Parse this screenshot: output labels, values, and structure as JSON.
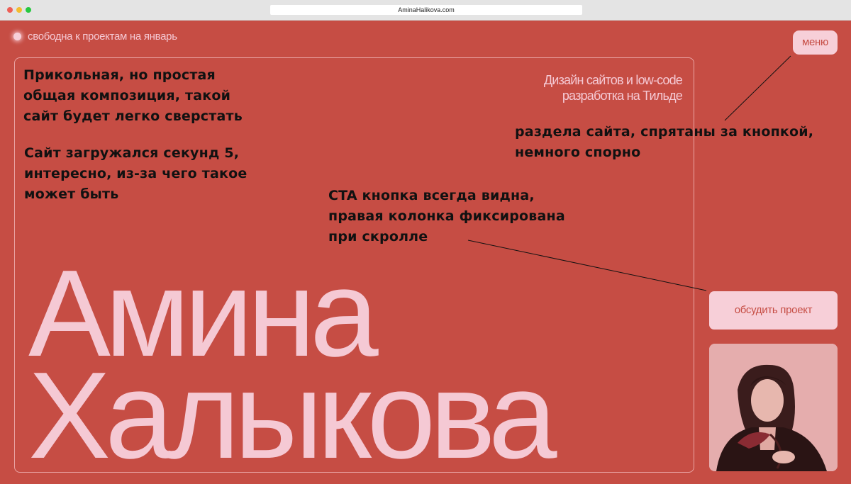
{
  "browser": {
    "url": "AminaHalikova.com"
  },
  "header": {
    "status_text": "свободна к проектам на январь",
    "menu_label": "меню"
  },
  "hero": {
    "tagline": "Дизайн сайтов и low-code\nразработка на Тильде",
    "name_first": "Амина",
    "name_last": "Халыкова"
  },
  "sidebar": {
    "cta_label": "обсудить проект"
  },
  "annotations": {
    "note1": "Прикольная, но простая\nобщая композиция, такой\nсайт будет легко сверстать",
    "note2": "Сайт загружался секунд 5,\nинтересно, из-за чего такое\nможет быть",
    "note3": "CTA кнопка всегда видна,\nправая колонка фиксирована\nпри скролле",
    "note4": "раздела сайта, спрятаны за кнопкой,\nнемного спорно"
  },
  "colors": {
    "background": "#c64d44",
    "accent_pink": "#f7cfd8",
    "annotation_text": "#111111"
  }
}
